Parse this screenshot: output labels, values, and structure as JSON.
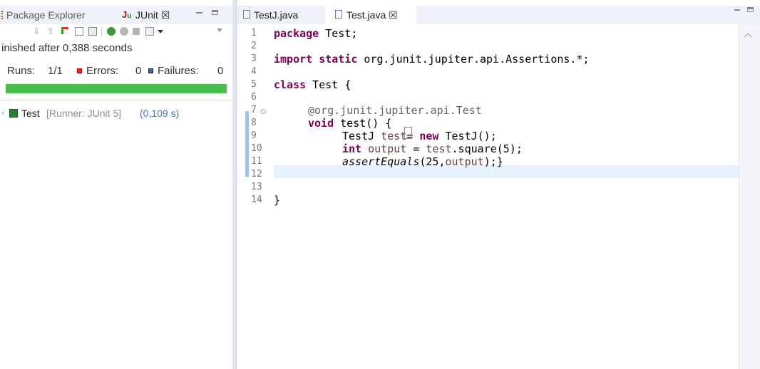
{
  "left_panel": {
    "tabs": [
      {
        "label": "Package Explorer"
      },
      {
        "label": "JUnit ☒",
        "active": true
      }
    ],
    "status_text": "inished after 0,388 seconds",
    "runs_label": "Runs:",
    "runs_value": "1/1",
    "errors_label": "Errors:",
    "errors_value": "0",
    "failures_label": "Failures:",
    "failures_value": "0",
    "progress": 1.0,
    "progress_color": "#4cbe4f",
    "tree_item": {
      "name": "Test",
      "runner": "[Runner: JUnit 5]",
      "time": "(0,109 s)"
    }
  },
  "editor": {
    "tabs": [
      {
        "label": "TestJ.java"
      },
      {
        "label": "Test.java ☒",
        "active": true
      }
    ],
    "line_numbers": [
      "1",
      "2",
      "3",
      "4",
      "5",
      "6",
      "7",
      "8",
      "9",
      "10",
      "11",
      "12",
      "13",
      "14"
    ],
    "code": {
      "l1_kw": "package",
      "l1_rest": " Test;",
      "l3_kw": "import static",
      "l3_rest": " org.junit.jupiter.api.Assertions.*;",
      "l5_kw": "class",
      "l5_rest": " Test {",
      "l7_ann": "@org.junit.jupiter.api.",
      "l7_ann2": "Test",
      "l8_kw": "void",
      "l8_rest": " test() ",
      "l8_brace": "{",
      "l9_a": "TestJ ",
      "l9_var": "test",
      "l9_b": "= ",
      "l9_kw": "new",
      "l9_c": " TestJ();",
      "l10_kw": "int",
      "l10_var": " output",
      "l10_a": " = ",
      "l10_var2": "test",
      "l10_b": ".square(5);",
      "l11_it": "assertEquals",
      "l11_a": "(25,",
      "l11_var": "output",
      "l11_b": ");}",
      "l13": "}"
    }
  }
}
